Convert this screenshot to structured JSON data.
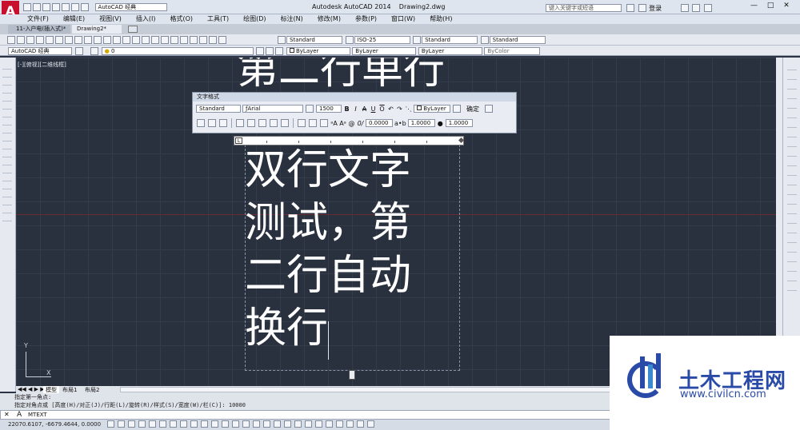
{
  "app": {
    "title": "Autodesk AutoCAD 2014",
    "file": "Drawing2.dwg",
    "search_placeholder": "键入关键字或短语",
    "login": "登录",
    "workspace": "AutoCAD 经典",
    "help": "?"
  },
  "menus": [
    "文件(F)",
    "编辑(E)",
    "视图(V)",
    "插入(I)",
    "格式(O)",
    "工具(T)",
    "绘图(D)",
    "标注(N)",
    "修改(M)",
    "参数(P)",
    "窗口(W)",
    "帮助(H)"
  ],
  "doc_tabs": [
    {
      "label": "11-入户电(插入式)*"
    },
    {
      "label": "Drawing2*"
    }
  ],
  "toolbar": {
    "text_style": "Standard",
    "dim_style": "ISO-25",
    "table_style": "Standard",
    "mleader_style": "Standard",
    "workspace2": "AutoCAD 经典",
    "layer": "0",
    "color": "ByLayer",
    "linetype": "ByLayer",
    "lineweight": "ByLayer",
    "plotstyle": "ByColor"
  },
  "viewport_label": "[-][俯视][二维线框]",
  "canvas_text": {
    "line_above": "第二行单行",
    "lines": [
      "双行文字",
      "测试，第",
      "二行自动",
      "换行"
    ]
  },
  "text_format": {
    "title": "文字格式",
    "style": "Standard",
    "font": "Arial",
    "height": "1500",
    "color": "ByLayer",
    "ok": "确定",
    "oblique": "0.0000",
    "tracking": "1.0000",
    "width_factor": "1.0000"
  },
  "layout_tabs": [
    "模型",
    "布局1",
    "布局2"
  ],
  "command_history": [
    "指定第一角点:",
    "指定对角点或 [高度(H)/对正(J)/行距(L)/旋转(R)/样式(S)/宽度(W)/栏(C)]: 10000"
  ],
  "command_line": {
    "prompt": "MTEXT"
  },
  "status": {
    "coords": "22070.6107, -6679.4644, 0.0000"
  },
  "ucs": {
    "x": "X",
    "y": "Y"
  },
  "watermark": {
    "name": "土木工程网",
    "url": "www.civilcn.com"
  },
  "colors": {
    "canvas_bg": "#29303e",
    "ui_bg": "#e6eaf0",
    "accent_red": "#c8102e",
    "watermark_blue": "#2a4aa8"
  }
}
